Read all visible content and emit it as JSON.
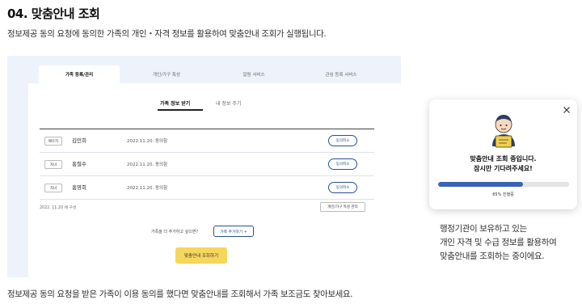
{
  "section": {
    "title": "04. 맞춤안내 조회",
    "description": "정보제공 동의 요청에 동의한 가족의 개인・자격 정보를 활용하여 맞춤안내 조회가 실행됩니다.",
    "footer": "정보제공 동의 요청을 받은 가족이 이용 동의를 했다면 맞춤안내를 조회해서 가족 보조금도 찾아보세요."
  },
  "mock": {
    "tabs": [
      "가족 등록/관리",
      "개인/가구 특성",
      "알림 서비스",
      "관심 등록 서비스"
    ],
    "active_tab": 0,
    "subtabs": [
      "가족 정보 받기",
      "내 정보 주기"
    ],
    "rows": [
      {
        "relation": "배우자",
        "name": "김민희",
        "date": "2022.11.20. 동의함",
        "action": "동의취소"
      },
      {
        "relation": "자녀",
        "name": "홍철수",
        "date": "2022.11.20. 동의함",
        "action": "동의취소"
      },
      {
        "relation": "자녀",
        "name": "홍영희",
        "date": "2022.11.20. 동의함",
        "action": "동의취소"
      }
    ],
    "status_line": "2022. 11.20 에 구성",
    "property_button": "개인/가구 특성 관리",
    "add_question": "가족을 더 추가하고 싶으면?",
    "add_button": "가족 추가하기 +",
    "lookup_button": "맞춤안내 조회하기"
  },
  "popup": {
    "message_line1": "맞춤안내 조회 중입니다.",
    "message_line2": "잠시만 기다려주세요!",
    "progress": 0.65,
    "progress_text": "65% 진행중",
    "close_icon": "close-icon",
    "illustration": "person-with-document-icon"
  },
  "side_text": [
    "행정기관이 보유하고 있는",
    "개인 자격 및 수급 정보를 활용하여",
    "맞춤안내를 조회하는 중이에요."
  ],
  "colors": {
    "accent": "#3a64b3",
    "button_yellow": "#f6d65c",
    "frame_bg": "#eef3fb"
  }
}
